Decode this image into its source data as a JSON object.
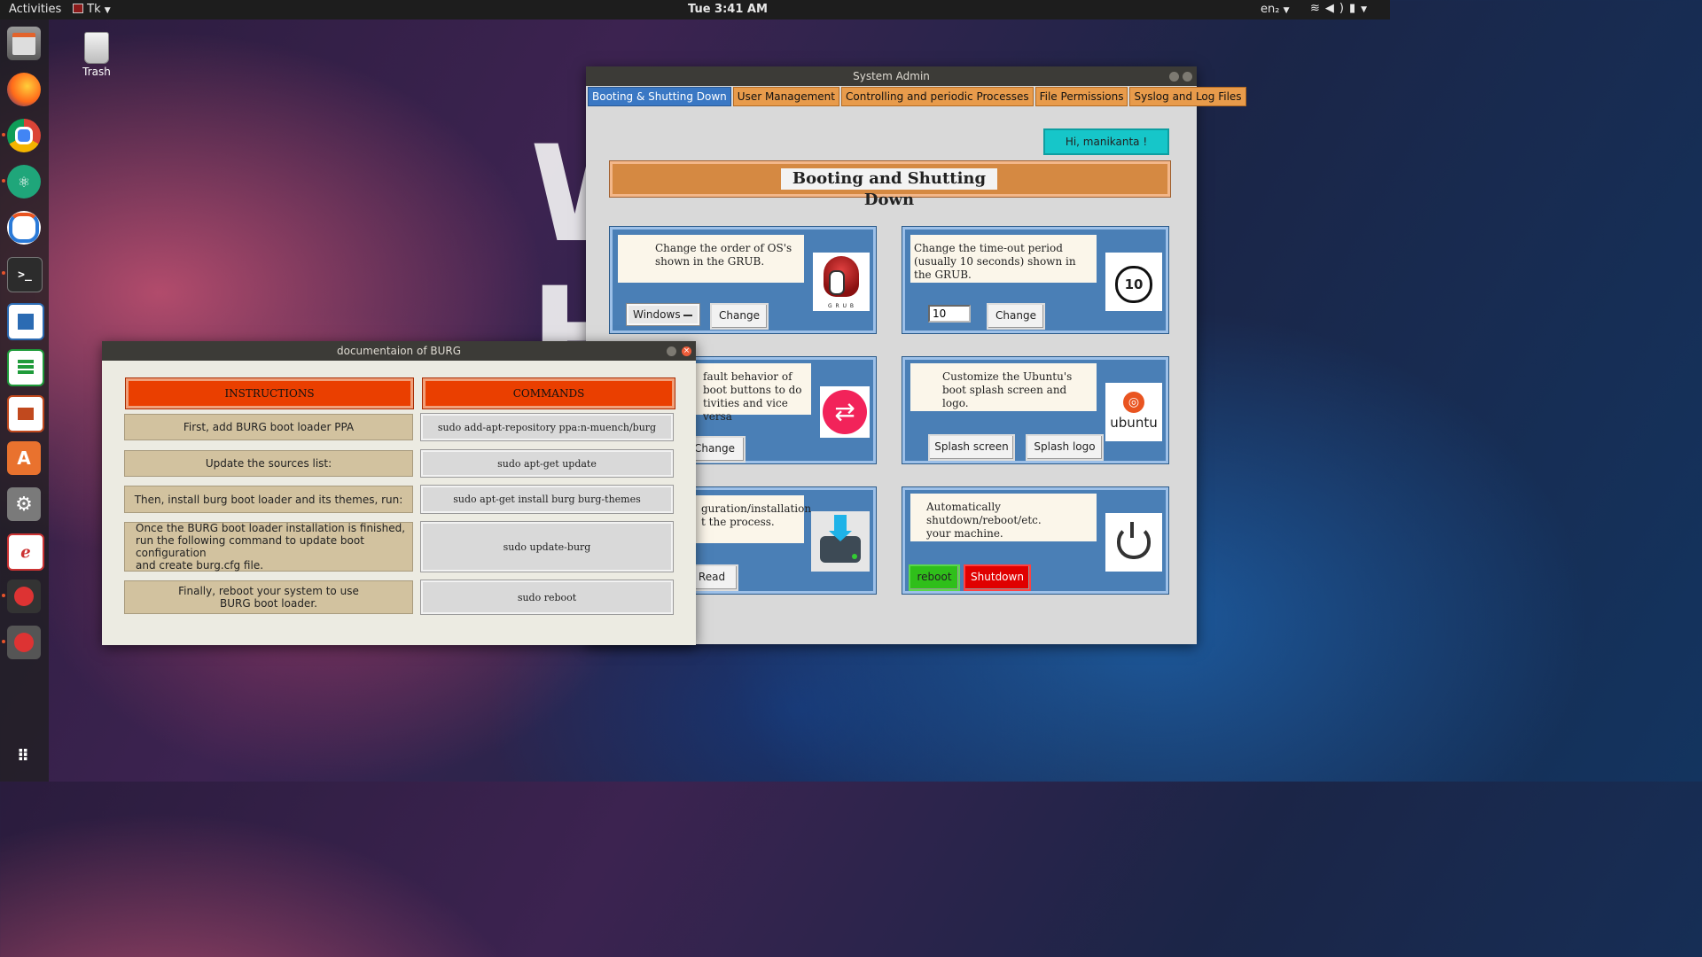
{
  "topbar": {
    "activities": "Activities",
    "app_menu": "Tk",
    "clock": "Tue  3:41 AM",
    "lang": "en₂"
  },
  "desktop": {
    "trash_label": "Trash",
    "background_text": "W\nH"
  },
  "dock": {
    "icons": [
      "files-icon",
      "firefox-icon",
      "chrome-icon",
      "atom-icon",
      "ubuntu-software-updater-icon",
      "terminal-icon",
      "writer-icon",
      "calc-icon",
      "impress-icon",
      "software-center-icon",
      "system-tools-icon",
      "document-viewer-icon",
      "tk-app-icon",
      "tk-app-icon",
      "show-apps-icon"
    ]
  },
  "sysadmin": {
    "title": "System Admin",
    "tabs": [
      "Booting & Shutting Down",
      "User Management",
      "Controlling and periodic Processes",
      "File Permissions",
      "Syslog and Log Files"
    ],
    "greeting": "Hi, manikanta !",
    "heading": "Booting and Shutting Down",
    "card_grub_order": {
      "desc": "Change the order of OS's\nshown in the GRUB.",
      "select_value": "Windows",
      "button": "Change",
      "image_caption": "G R U B"
    },
    "card_timeout": {
      "desc": "Change the time-out period\n(usually 10 seconds) shown in the GRUB.",
      "input_value": "10",
      "button": "Change",
      "image_number": "10"
    },
    "card_default": {
      "desc": "fault behavior of\nboot buttons to do\ntivities and vice versa",
      "button": "Change"
    },
    "card_splash": {
      "desc": "Customize the Ubuntu's\nboot splash screen and logo.",
      "button_screen": "Splash screen",
      "button_logo": "Splash logo",
      "logo_text": "ubuntu"
    },
    "card_install": {
      "desc": "guration/installation\nt the process.",
      "button": "Read"
    },
    "card_power": {
      "desc": "Automatically shutdown/reboot/etc.\nyour machine.",
      "button_reboot": "reboot",
      "button_shutdown": "Shutdown"
    }
  },
  "burg": {
    "title": "documentaion of BURG",
    "headers": {
      "instructions": "INSTRUCTIONS",
      "commands": "COMMANDS"
    },
    "rows": [
      {
        "instruction": "First, add BURG boot loader PPA",
        "command": "sudo add-apt-repository ppa:n-muench/burg"
      },
      {
        "instruction": "Update the sources list:",
        "command": "sudo apt-get update"
      },
      {
        "instruction": "Then, install burg boot loader and its themes, run:",
        "command": "sudo apt-get install burg burg-themes"
      },
      {
        "instruction": "Once the BURG boot loader installation is finished,\nrun the following command to update boot configuration\nand create burg.cfg file.",
        "command": "sudo update-burg"
      },
      {
        "instruction": "Finally, reboot your system to use\nBURG boot loader.",
        "command": "sudo reboot"
      }
    ]
  },
  "colors": {
    "tab_active": "#3a78c4",
    "tab": "#e89b4b",
    "card_bg": "#4a7fb6",
    "greet_bg": "#16c6c9",
    "header_orange": "#ea3f00",
    "reboot_green": "#2fbf1a",
    "shutdown_red": "#e00000"
  }
}
